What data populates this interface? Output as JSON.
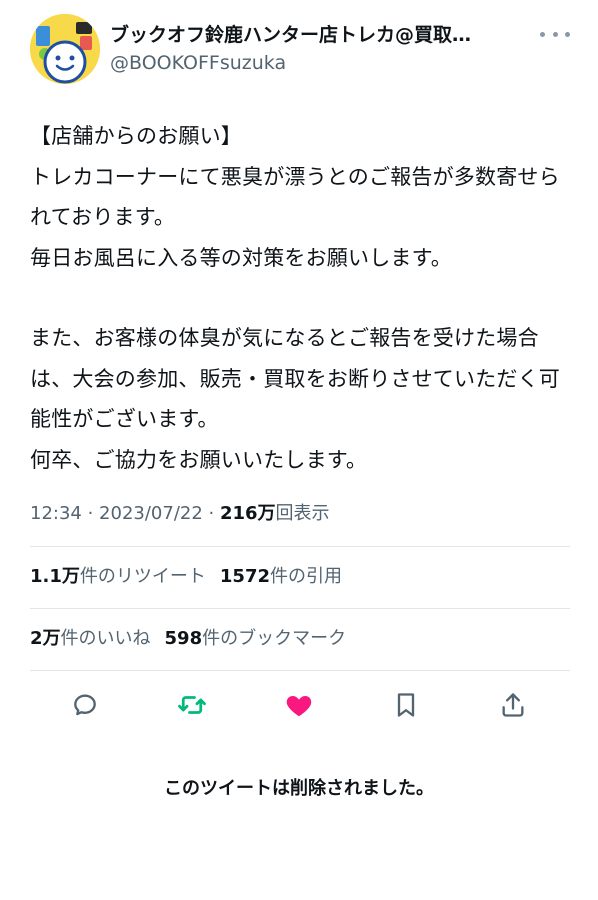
{
  "author": {
    "display_name": "ブックオフ鈴鹿ハンター店トレカ@買取…",
    "handle": "@BOOKOFFsuzuka",
    "avatar_icon": "smiley-mascot-avatar"
  },
  "tweet": {
    "paragraph1": "【店舗からのお願い】\nトレカコーナーにて悪臭が漂うとのご報告が多数寄せられております。\n毎日お風呂に入る等の対策をお願いします。",
    "paragraph2": "また、お客様の体臭が気になるとご報告を受けた場合は、大会の参加、販売・買取をお断りさせていただく可能性がございます。\n何卒、ご協力をお願いいたします。"
  },
  "meta": {
    "time": "12:34",
    "separator": " · ",
    "date": "2023/07/22",
    "separator2": " · ",
    "views_count": "216万",
    "views_label": "回表示"
  },
  "stats": {
    "retweets_count": "1.1万",
    "retweets_label": "件のリツイート",
    "quotes_count": "1572",
    "quotes_label": "件の引用",
    "likes_count": "2万",
    "likes_label": "件のいいね",
    "bookmarks_count": "598",
    "bookmarks_label": "件のブックマーク"
  },
  "actions": {
    "reply_icon": "reply-icon",
    "retweet_icon": "retweet-icon",
    "like_icon": "heart-icon",
    "bookmark_icon": "bookmark-icon",
    "share_icon": "share-icon",
    "retweet_color": "#00ba7c",
    "like_color": "#f91880",
    "neutral_color": "#536471"
  },
  "deleted_notice": "このツイートは削除されました。"
}
